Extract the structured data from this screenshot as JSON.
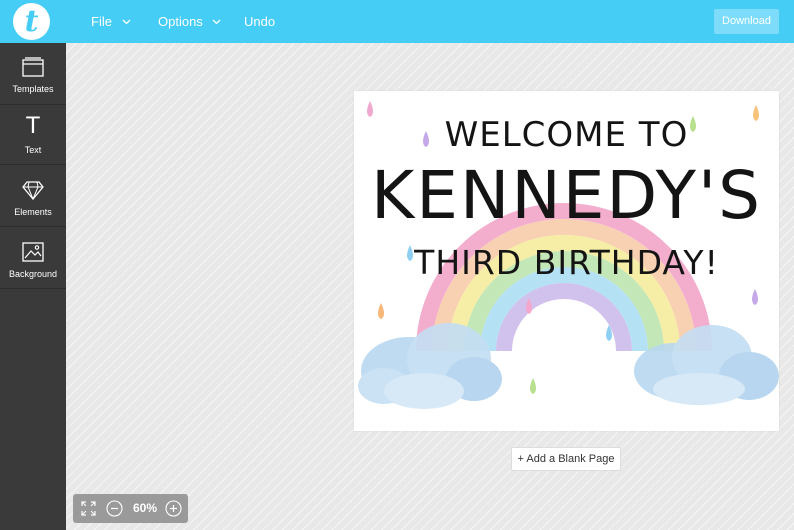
{
  "header": {
    "logo_letter": "t",
    "menu": {
      "file": "File",
      "options": "Options",
      "undo": "Undo"
    },
    "download_label": "Download"
  },
  "sidebar": {
    "items": [
      {
        "label": "Templates",
        "icon": "templates-icon"
      },
      {
        "label": "Text",
        "icon": "text-icon",
        "glyph": "T"
      },
      {
        "label": "Elements",
        "icon": "diamond-icon"
      },
      {
        "label": "Background",
        "icon": "image-icon"
      }
    ]
  },
  "design": {
    "line1": "WELCOME TO",
    "line2": "KENNEDY'S",
    "line3": "THIRD BIRTHDAY!",
    "colors": {
      "rainbow": [
        "#f2a0c4",
        "#f7c9a6",
        "#f5ec9d",
        "#b8e3a9",
        "#a8dcf3",
        "#c9b6ea"
      ],
      "cloud": "#b9d8f0",
      "text": "#141414"
    }
  },
  "canvas": {
    "add_page_label": "+ Add a Blank Page"
  },
  "zoom": {
    "level": "60%"
  },
  "colors": {
    "topbar": "#45cdf6",
    "sidebar": "#3a3a3a",
    "download_button": "#7ddcf9"
  }
}
